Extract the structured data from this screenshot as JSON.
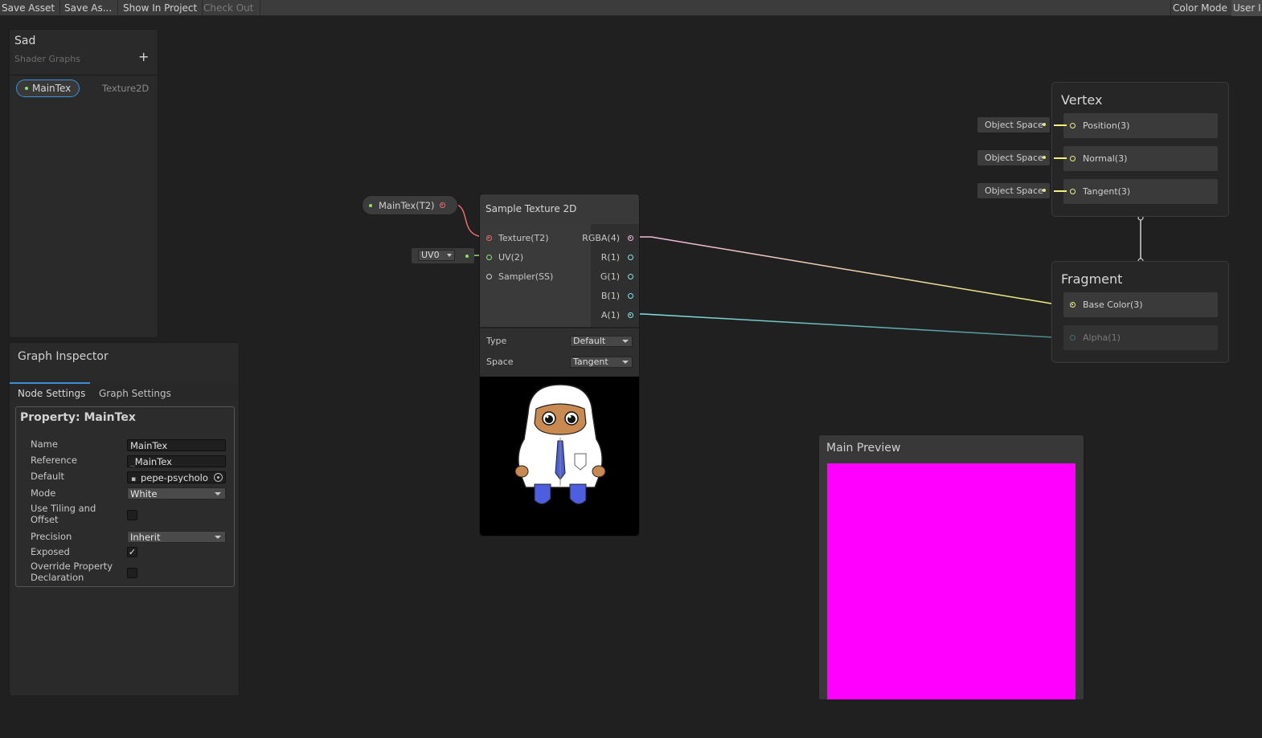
{
  "toolbar": {
    "save_asset": "Save Asset",
    "save_as": "Save As...",
    "show_in_project": "Show In Project",
    "check_out": "Check Out",
    "color_mode": "Color Mode",
    "user": "User I"
  },
  "blackboard": {
    "title": "Sad",
    "subtitle": "Shader Graphs",
    "add_icon": "plus-icon",
    "properties": [
      {
        "name": "MainTex",
        "type": "Texture2D"
      }
    ]
  },
  "inspector": {
    "title": "Graph Inspector",
    "tabs": [
      "Node Settings",
      "Graph Settings"
    ],
    "active_tab": "Node Settings",
    "section_title": "Property: MainTex",
    "fields": {
      "name_label": "Name",
      "name_value": "MainTex",
      "reference_label": "Reference",
      "reference_value": "_MainTex",
      "default_label": "Default",
      "default_value": "pepe-psycholo",
      "mode_label": "Mode",
      "mode_value": "White",
      "tiling_label_1": "Use Tiling and",
      "tiling_label_2": "Offset",
      "tiling_checked": false,
      "precision_label": "Precision",
      "precision_value": "Inherit",
      "exposed_label": "Exposed",
      "exposed_checked": true,
      "override_label_1": "Override Property",
      "override_label_2": "Declaration",
      "override_checked": false
    }
  },
  "graph": {
    "property_node": {
      "label": "MainTex(T2)"
    },
    "uv_node": {
      "value": "UV0"
    },
    "sample_node": {
      "title": "Sample Texture 2D",
      "inputs": [
        "Texture(T2)",
        "UV(2)",
        "Sampler(SS)"
      ],
      "outputs": [
        "RGBA(4)",
        "R(1)",
        "G(1)",
        "B(1)",
        "A(1)"
      ],
      "type_label": "Type",
      "type_value": "Default",
      "space_label": "Space",
      "space_value": "Tangent"
    },
    "vertex": {
      "title": "Vertex",
      "slots": [
        {
          "label": "Position(3)",
          "space": "Object Space"
        },
        {
          "label": "Normal(3)",
          "space": "Object Space"
        },
        {
          "label": "Tangent(3)",
          "space": "Object Space"
        }
      ]
    },
    "fragment": {
      "title": "Fragment",
      "slots": [
        {
          "label": "Base Color(3)"
        },
        {
          "label": "Alpha(1)"
        }
      ]
    }
  },
  "main_preview": {
    "title": "Main Preview",
    "color": "#ff00ff"
  },
  "colors": {
    "texture_port": "#f06a6a",
    "uv_port": "#8de26d",
    "vector4": "#f2b6df",
    "vector3": "#f0f07a",
    "float": "#84e4e7",
    "preview_magenta": "#ff00ff"
  }
}
